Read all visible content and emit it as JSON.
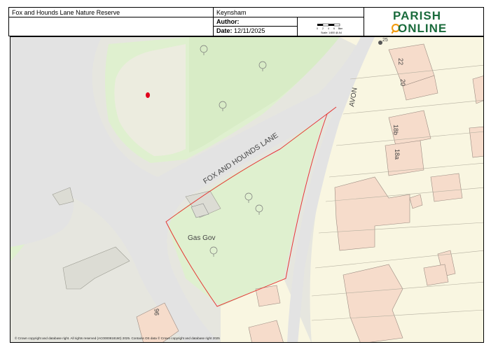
{
  "header": {
    "title": "Fox and Hounds Lane Nature Reserve",
    "place": "Keynsham",
    "author_label": "Author:",
    "date_label": "Date:",
    "date_value": "12/11/2025",
    "scale_text": "Scale: 1:800 @ A4",
    "scale_ticks": [
      "0",
      "2",
      "4",
      "6",
      "8km"
    ]
  },
  "logo": {
    "line1": "PARISH",
    "line2": "ONLINE"
  },
  "map": {
    "road_label": "FOX AND  HOUNDS LANE",
    "avon_label": "AVON",
    "site_label": "Gas Gov",
    "house_labels": [
      "22",
      "20",
      "18b",
      "18a",
      "96",
      "25"
    ],
    "colors": {
      "road": "#e3e3e3",
      "green": "#dff0cf",
      "building": "#f6dccb",
      "land": "#f9f6e1",
      "boundary": "#e53935",
      "marker": "#e0001b"
    }
  },
  "footer": {
    "copyright": "© Crown copyright and database right. All rights reserved (AC0000818160) 2025. Contains OS data © Crown copyright and database right 2025"
  }
}
